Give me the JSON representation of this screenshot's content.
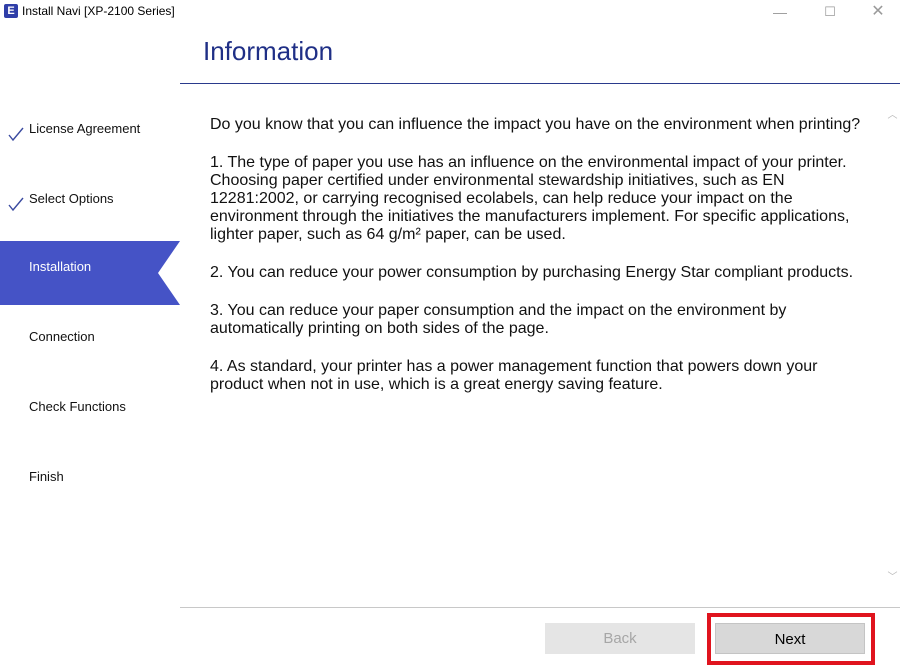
{
  "window": {
    "title": "Install Navi [XP-2100 Series]",
    "app_icon": "E",
    "controls": {
      "minimize": "—",
      "maximize": "☐",
      "close": "✕"
    }
  },
  "header": {
    "title": "Information"
  },
  "sidebar": {
    "steps": [
      {
        "label": "License Agreement",
        "state": "done",
        "icon": "check-icon"
      },
      {
        "label": "Select Options",
        "state": "done",
        "icon": "check-icon"
      },
      {
        "label": "Installation",
        "state": "active"
      },
      {
        "label": "Connection",
        "state": "pending"
      },
      {
        "label": "Check Functions",
        "state": "pending"
      },
      {
        "label": "Finish",
        "state": "pending"
      }
    ]
  },
  "content": {
    "paragraphs": [
      "Do you know that you can influence the impact you have on the environment when printing?",
      "1. The type of paper you use has an influence on the environmental impact of your printer. Choosing paper certified under environmental stewardship initiatives, such as EN 12281:2002, or carrying recognised ecolabels, can help reduce your impact on the environment through the initiatives the manufacturers implement. For specific applications, lighter paper, such as 64 g/m² paper, can be used.",
      "2. You can reduce your power consumption by purchasing Energy Star compliant products.",
      "3. You can reduce your paper consumption and the impact on the environment by automatically printing on both sides of the page.",
      "4. As standard, your printer has a power management function that powers down your product when not in use, which is a great energy saving feature."
    ]
  },
  "footer": {
    "back_label": "Back",
    "next_label": "Next",
    "back_enabled": false
  },
  "colors": {
    "accent": "#4553c6",
    "title": "#1f2f86",
    "highlight": "#e0141e"
  }
}
